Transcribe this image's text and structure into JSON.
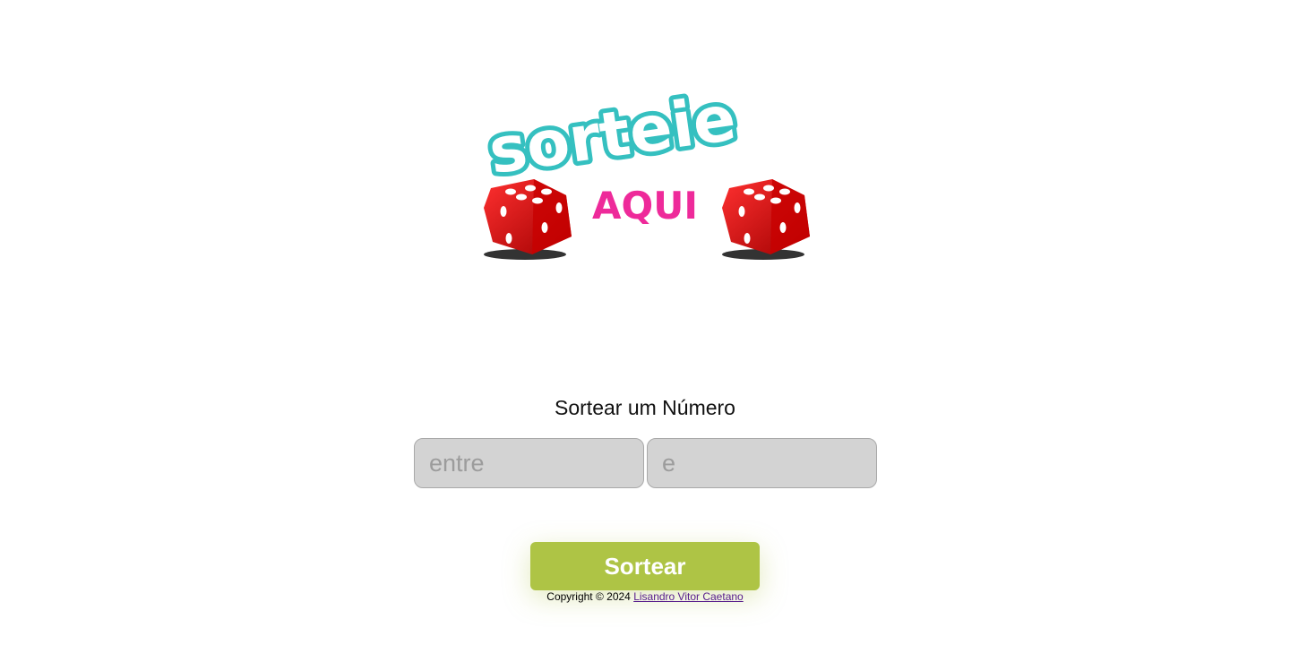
{
  "logo": {
    "title": "sorteie",
    "subtitle": "AQUI",
    "colors": {
      "title_fill": "#ffffff",
      "title_outline": "#35c0c0",
      "subtitle": "#ee2a9a",
      "dice": "#dd0000"
    }
  },
  "main": {
    "heading": "Sortear um Número",
    "inputs": [
      {
        "placeholder": "entre",
        "value": ""
      },
      {
        "placeholder": "e",
        "value": ""
      }
    ],
    "button_label": "Sortear",
    "button_color": "#aec445"
  },
  "footer": {
    "copyright": "Copyright © 2024",
    "author": "Lisandro Vitor Caetano"
  }
}
